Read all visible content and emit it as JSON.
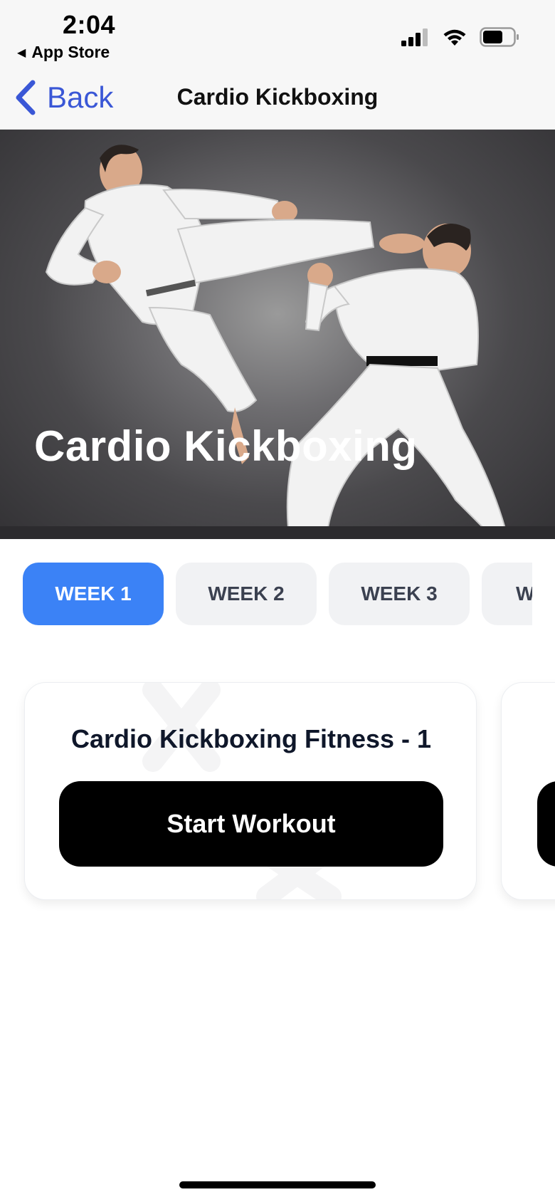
{
  "status_bar": {
    "time": "2:04",
    "back_app_label": "App Store",
    "icons": [
      "cellular-signal-icon",
      "wifi-icon",
      "battery-icon"
    ]
  },
  "nav": {
    "back_label": "Back",
    "title": "Cardio Kickboxing",
    "accent_color": "#3a57d6"
  },
  "hero": {
    "title": "Cardio Kickboxing",
    "image": "karate-kick-photo"
  },
  "weeks": {
    "active_color": "#3b82f6",
    "tabs": [
      {
        "label": "WEEK 1",
        "active": true
      },
      {
        "label": "WEEK 2",
        "active": false
      },
      {
        "label": "WEEK 3",
        "active": false
      },
      {
        "label": "W",
        "active": false
      }
    ]
  },
  "workouts": [
    {
      "title": "Cardio Kickboxing Fitness - 1",
      "button_label": "Start Workout"
    }
  ]
}
